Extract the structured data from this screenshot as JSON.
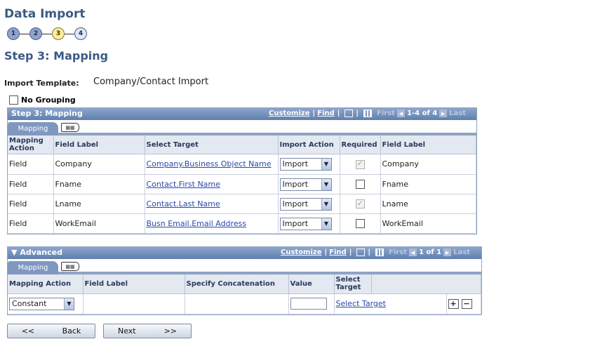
{
  "page": {
    "title": "Data Import",
    "steps": [
      "1",
      "2",
      "3",
      "4"
    ],
    "step_heading": "Step 3: Mapping",
    "template_label": "Import Template:",
    "template_value": "Company/Contact Import",
    "no_grouping_label": "No Grouping"
  },
  "mapping_grid": {
    "title": "Step 3: Mapping",
    "customize": "Customize",
    "find": "Find",
    "first": "First",
    "count": "1-4 of 4",
    "last": "Last",
    "tab_label": "Mapping",
    "headers": [
      "Mapping Action",
      "Field Label",
      "Select Target",
      "Import Action",
      "Required",
      "Field Label"
    ],
    "rows": [
      {
        "action": "Field",
        "label": "Company",
        "target": "Company.Business Object Name",
        "import": "Import",
        "required": true,
        "label2": "Company"
      },
      {
        "action": "Field",
        "label": "Fname",
        "target": "Contact.First Name",
        "import": "Import",
        "required": false,
        "label2": "Fname"
      },
      {
        "action": "Field",
        "label": "Lname",
        "target": "Contact.Last Name",
        "import": "Import",
        "required": true,
        "label2": "Lname"
      },
      {
        "action": "Field",
        "label": "WorkEmail",
        "target": "Busn Email.Email Address",
        "import": "Import",
        "required": false,
        "label2": "WorkEmail"
      }
    ]
  },
  "advanced_grid": {
    "title": "Advanced",
    "customize": "Customize",
    "find": "Find",
    "first": "First",
    "count": "1 of 1",
    "last": "Last",
    "tab_label": "Mapping",
    "headers": [
      "Mapping Action",
      "Field Label",
      "Specify Concatenation",
      "Value",
      "Select Target"
    ],
    "row": {
      "action": "Constant",
      "field_label": "",
      "concat": "",
      "value": "",
      "target": "Select Target"
    }
  },
  "buttons": {
    "back_arrows": "<<",
    "back": "Back",
    "next": "Next",
    "next_arrows": ">>"
  }
}
